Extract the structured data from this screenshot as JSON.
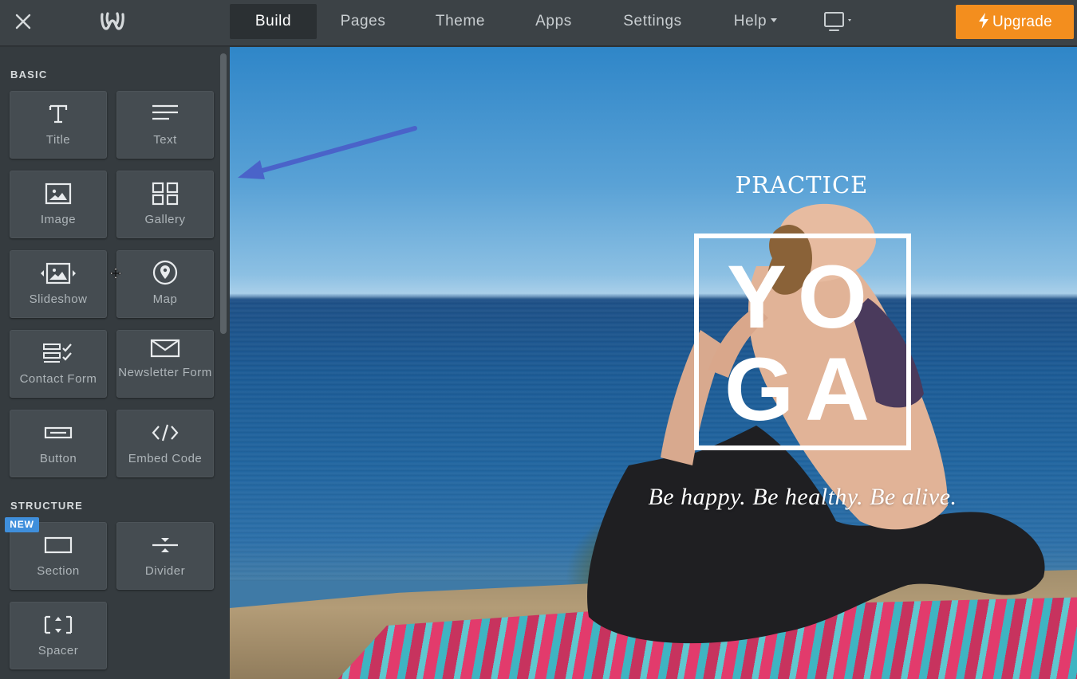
{
  "topbar": {
    "tabs": [
      {
        "label": "Build",
        "active": true
      },
      {
        "label": "Pages"
      },
      {
        "label": "Theme"
      },
      {
        "label": "Apps"
      },
      {
        "label": "Settings"
      },
      {
        "label": "Help",
        "has_dropdown": true
      }
    ],
    "upgrade_label": "Upgrade",
    "upgrade_color": "#f38e1e"
  },
  "sidebar": {
    "basic_label": "BASIC",
    "structure_label": "STRUCTURE",
    "new_badge": "NEW",
    "basic_items": [
      {
        "label": "Title",
        "icon": "title-icon"
      },
      {
        "label": "Text",
        "icon": "text-icon"
      },
      {
        "label": "Image",
        "icon": "image-icon"
      },
      {
        "label": "Gallery",
        "icon": "gallery-icon"
      },
      {
        "label": "Slideshow",
        "icon": "slideshow-icon"
      },
      {
        "label": "Map",
        "icon": "map-pin-icon"
      },
      {
        "label": "Contact Form",
        "icon": "contact-form-icon"
      },
      {
        "label": "Newsletter Form",
        "icon": "envelope-icon"
      },
      {
        "label": "Button",
        "icon": "button-icon"
      },
      {
        "label": "Embed Code",
        "icon": "code-icon"
      }
    ],
    "structure_items": [
      {
        "label": "Section",
        "icon": "section-icon"
      },
      {
        "label": "Divider",
        "icon": "divider-icon"
      },
      {
        "label": "Spacer",
        "icon": "spacer-icon"
      }
    ]
  },
  "canvas": {
    "practice": "PRACTICE",
    "yoga_line1": "YO",
    "yoga_line2": "GA",
    "tagline": "Be happy. Be healthy. Be alive.",
    "annotation_arrow_color": "#4a63c9"
  }
}
